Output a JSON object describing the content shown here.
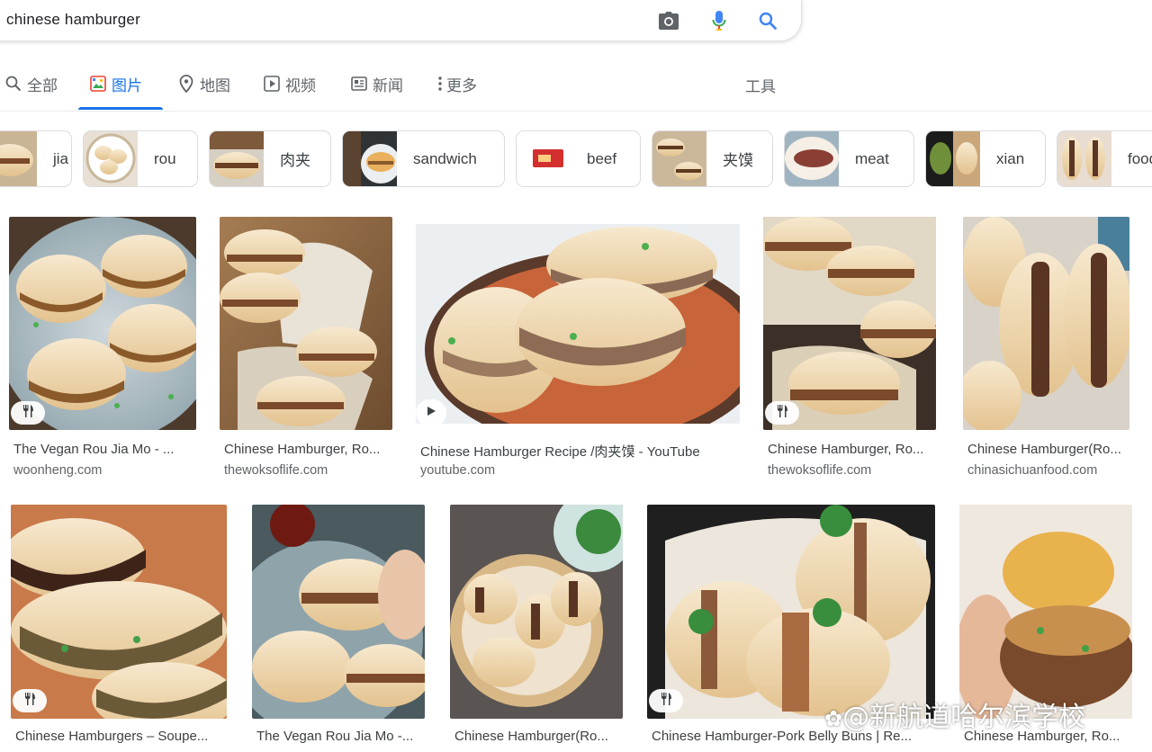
{
  "search": {
    "query": "chinese hamburger",
    "camera_icon": "camera-icon",
    "mic_icon": "mic-icon",
    "search_icon": "search-icon"
  },
  "tabs": [
    {
      "label": "全部",
      "icon": "search-icon"
    },
    {
      "label": "图片",
      "icon": "image-icon",
      "active": true
    },
    {
      "label": "地图",
      "icon": "map-pin-icon"
    },
    {
      "label": "视频",
      "icon": "play-icon"
    },
    {
      "label": "新闻",
      "icon": "news-icon"
    },
    {
      "label": "更多",
      "icon": "more-vert-icon"
    }
  ],
  "tools_label": "工具",
  "chips": [
    "jia",
    "rou",
    "肉夹",
    "sandwich",
    "beef",
    "夹馍",
    "meat",
    "xian",
    "food"
  ],
  "results_row1": [
    {
      "title": "The Vegan Rou Jia Mo - ...",
      "source": "woonheng.com",
      "badge": "recipe"
    },
    {
      "title": "Chinese Hamburger, Ro...",
      "source": "thewoksoflife.com",
      "badge": ""
    },
    {
      "title": "Chinese Hamburger Recipe /肉夹馍 - YouTube",
      "source": "youtube.com",
      "badge": "video"
    },
    {
      "title": "Chinese Hamburger, Ro...",
      "source": "thewoksoflife.com",
      "badge": "recipe"
    },
    {
      "title": "Chinese Hamburger(Ro...",
      "source": "chinasichuanfood.com",
      "badge": ""
    }
  ],
  "results_row2": [
    {
      "title": "Chinese Hamburgers – Soupe...",
      "badge": "recipe"
    },
    {
      "title": "The Vegan Rou Jia Mo -...",
      "badge": ""
    },
    {
      "title": "Chinese Hamburger(Ro...",
      "badge": ""
    },
    {
      "title": "Chinese Hamburger-Pork Belly Buns | Re...",
      "badge": "recipe"
    },
    {
      "title": "Chinese Hamburger, Ro...",
      "badge": ""
    }
  ],
  "watermark": "@新航道哈尔滨学校",
  "colors": {
    "accent": "#1a73e8",
    "text": "#202124",
    "muted": "#5f6368"
  }
}
